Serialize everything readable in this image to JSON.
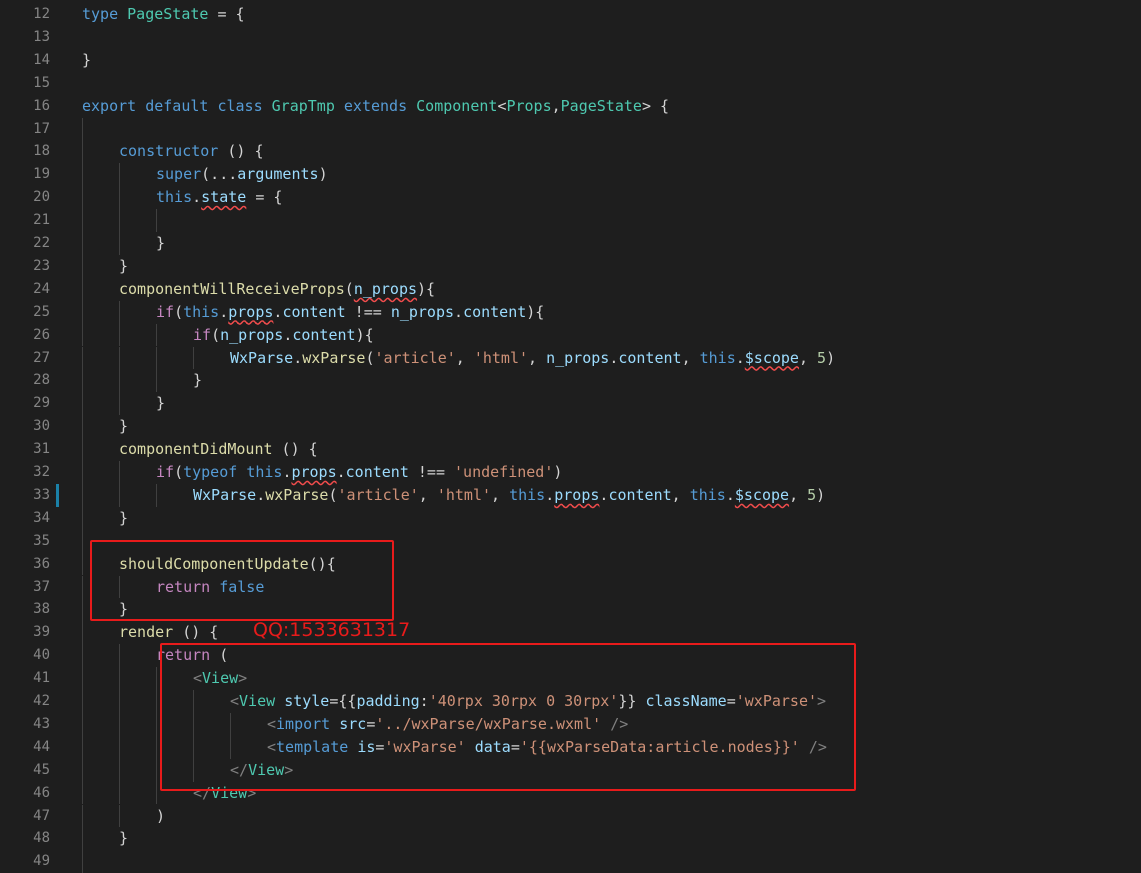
{
  "editor": {
    "lines": [
      {
        "n": "12",
        "indent": 0,
        "t": [
          [
            "kw",
            "type"
          ],
          [
            "pl",
            " "
          ],
          [
            "ty",
            "PageState"
          ],
          [
            "pl",
            " = {"
          ]
        ]
      },
      {
        "n": "13",
        "indent": 0,
        "t": []
      },
      {
        "n": "14",
        "indent": 0,
        "t": [
          [
            "pl",
            "}"
          ]
        ]
      },
      {
        "n": "15",
        "indent": 0,
        "t": []
      },
      {
        "n": "16",
        "indent": 0,
        "t": [
          [
            "kw",
            "export"
          ],
          [
            "pl",
            " "
          ],
          [
            "kw",
            "default"
          ],
          [
            "pl",
            " "
          ],
          [
            "kw",
            "class"
          ],
          [
            "pl",
            " "
          ],
          [
            "ty",
            "GrapTmp"
          ],
          [
            "pl",
            " "
          ],
          [
            "kw",
            "extends"
          ],
          [
            "pl",
            " "
          ],
          [
            "ty",
            "Component"
          ],
          [
            "pl",
            "<"
          ],
          [
            "ty",
            "Props"
          ],
          [
            "pl",
            ","
          ],
          [
            "ty",
            "PageState"
          ],
          [
            "pl",
            "> {"
          ]
        ]
      },
      {
        "n": "17",
        "indent": 1,
        "t": []
      },
      {
        "n": "18",
        "indent": 1,
        "t": [
          [
            "kw",
            "constructor"
          ],
          [
            "pl",
            " () {"
          ]
        ]
      },
      {
        "n": "19",
        "indent": 2,
        "t": [
          [
            "kw",
            "super"
          ],
          [
            "pl",
            "(..."
          ],
          [
            "var",
            "arguments"
          ],
          [
            "pl",
            ")"
          ]
        ]
      },
      {
        "n": "20",
        "indent": 2,
        "t": [
          [
            "kw",
            "this"
          ],
          [
            "pl",
            "."
          ],
          [
            "var sq",
            "state"
          ],
          [
            "pl",
            " = {"
          ]
        ]
      },
      {
        "n": "21",
        "indent": 3,
        "t": []
      },
      {
        "n": "22",
        "indent": 2,
        "t": [
          [
            "pl",
            "}"
          ]
        ]
      },
      {
        "n": "23",
        "indent": 1,
        "t": [
          [
            "pl",
            "}"
          ]
        ]
      },
      {
        "n": "24",
        "indent": 1,
        "t": [
          [
            "fn",
            "componentWillReceiveProps"
          ],
          [
            "pl",
            "("
          ],
          [
            "var sq",
            "n_props"
          ],
          [
            "pl",
            "){"
          ]
        ]
      },
      {
        "n": "25",
        "indent": 2,
        "t": [
          [
            "ctl",
            "if"
          ],
          [
            "pl",
            "("
          ],
          [
            "kw",
            "this"
          ],
          [
            "pl",
            "."
          ],
          [
            "var sq",
            "props"
          ],
          [
            "pl",
            "."
          ],
          [
            "var",
            "content"
          ],
          [
            "pl",
            " !== "
          ],
          [
            "var",
            "n_props"
          ],
          [
            "pl",
            "."
          ],
          [
            "var",
            "content"
          ],
          [
            "pl",
            "){"
          ]
        ]
      },
      {
        "n": "26",
        "indent": 3,
        "t": [
          [
            "ctl",
            "if"
          ],
          [
            "pl",
            "("
          ],
          [
            "var",
            "n_props"
          ],
          [
            "pl",
            "."
          ],
          [
            "var",
            "content"
          ],
          [
            "pl",
            "){"
          ]
        ]
      },
      {
        "n": "27",
        "indent": 4,
        "t": [
          [
            "var",
            "WxParse"
          ],
          [
            "pl",
            "."
          ],
          [
            "fn",
            "wxParse"
          ],
          [
            "pl",
            "("
          ],
          [
            "str",
            "'article'"
          ],
          [
            "pl",
            ", "
          ],
          [
            "str",
            "'html'"
          ],
          [
            "pl",
            ", "
          ],
          [
            "var",
            "n_props"
          ],
          [
            "pl",
            "."
          ],
          [
            "var",
            "content"
          ],
          [
            "pl",
            ", "
          ],
          [
            "kw",
            "this"
          ],
          [
            "pl",
            "."
          ],
          [
            "var sq",
            "$scope"
          ],
          [
            "pl",
            ", "
          ],
          [
            "num",
            "5"
          ],
          [
            "pl",
            ")"
          ]
        ]
      },
      {
        "n": "28",
        "indent": 3,
        "t": [
          [
            "pl",
            "}"
          ]
        ]
      },
      {
        "n": "29",
        "indent": 2,
        "t": [
          [
            "pl",
            "}"
          ]
        ]
      },
      {
        "n": "30",
        "indent": 1,
        "t": [
          [
            "pl",
            "}"
          ]
        ]
      },
      {
        "n": "31",
        "indent": 1,
        "t": [
          [
            "fn",
            "componentDidMount"
          ],
          [
            "pl",
            " () {"
          ]
        ]
      },
      {
        "n": "32",
        "indent": 2,
        "t": [
          [
            "ctl",
            "if"
          ],
          [
            "pl",
            "("
          ],
          [
            "kw",
            "typeof"
          ],
          [
            "pl",
            " "
          ],
          [
            "kw",
            "this"
          ],
          [
            "pl",
            "."
          ],
          [
            "var sq",
            "props"
          ],
          [
            "pl",
            "."
          ],
          [
            "var",
            "content"
          ],
          [
            "pl",
            " !== "
          ],
          [
            "str",
            "'undefined'"
          ],
          [
            "pl",
            ")"
          ]
        ]
      },
      {
        "n": "33",
        "indent": 3,
        "t": [
          [
            "var",
            "WxParse"
          ],
          [
            "pl",
            "."
          ],
          [
            "fn",
            "wxParse"
          ],
          [
            "pl",
            "("
          ],
          [
            "str",
            "'article'"
          ],
          [
            "pl",
            ", "
          ],
          [
            "str",
            "'html'"
          ],
          [
            "pl",
            ", "
          ],
          [
            "kw",
            "this"
          ],
          [
            "pl",
            "."
          ],
          [
            "var sq",
            "props"
          ],
          [
            "pl",
            "."
          ],
          [
            "var",
            "content"
          ],
          [
            "pl",
            ", "
          ],
          [
            "kw",
            "this"
          ],
          [
            "pl",
            "."
          ],
          [
            "var sq",
            "$scope"
          ],
          [
            "pl",
            ", "
          ],
          [
            "num",
            "5"
          ],
          [
            "pl",
            ")"
          ]
        ]
      },
      {
        "n": "34",
        "indent": 1,
        "t": [
          [
            "pl",
            "}"
          ]
        ]
      },
      {
        "n": "35",
        "indent": 1,
        "t": []
      },
      {
        "n": "36",
        "indent": 1,
        "t": [
          [
            "fn",
            "shouldComponentUpdate"
          ],
          [
            "pl",
            "(){"
          ]
        ]
      },
      {
        "n": "37",
        "indent": 2,
        "t": [
          [
            "ctl",
            "return"
          ],
          [
            "pl",
            " "
          ],
          [
            "kw",
            "false"
          ]
        ]
      },
      {
        "n": "38",
        "indent": 1,
        "t": [
          [
            "pl",
            "}"
          ]
        ]
      },
      {
        "n": "39",
        "indent": 1,
        "t": [
          [
            "fn",
            "render"
          ],
          [
            "pl",
            " () {"
          ]
        ]
      },
      {
        "n": "40",
        "indent": 2,
        "t": [
          [
            "ctl",
            "return"
          ],
          [
            "pl",
            " ("
          ]
        ]
      },
      {
        "n": "41",
        "indent": 3,
        "t": [
          [
            "tagp",
            "<"
          ],
          [
            "tag",
            "View"
          ],
          [
            "tagp",
            ">"
          ]
        ]
      },
      {
        "n": "42",
        "indent": 4,
        "t": [
          [
            "tagp",
            "<"
          ],
          [
            "tag",
            "View"
          ],
          [
            "pl",
            " "
          ],
          [
            "var",
            "style"
          ],
          [
            "pl",
            "={{"
          ],
          [
            "var",
            "padding"
          ],
          [
            "pl",
            ":"
          ],
          [
            "str",
            "'40rpx 30rpx 0 30rpx'"
          ],
          [
            "pl",
            "}} "
          ],
          [
            "var",
            "className"
          ],
          [
            "pl",
            "="
          ],
          [
            "str",
            "'wxParse'"
          ],
          [
            "tagp",
            ">"
          ]
        ]
      },
      {
        "n": "43",
        "indent": 5,
        "t": [
          [
            "tagp",
            "<"
          ],
          [
            "kw",
            "import"
          ],
          [
            "pl",
            " "
          ],
          [
            "var",
            "src"
          ],
          [
            "pl",
            "="
          ],
          [
            "str",
            "'../wxParse/wxParse.wxml'"
          ],
          [
            "pl",
            " "
          ],
          [
            "tagp",
            "/>"
          ]
        ]
      },
      {
        "n": "44",
        "indent": 5,
        "t": [
          [
            "tagp",
            "<"
          ],
          [
            "kw",
            "template"
          ],
          [
            "pl",
            " "
          ],
          [
            "var",
            "is"
          ],
          [
            "pl",
            "="
          ],
          [
            "str",
            "'wxParse'"
          ],
          [
            "pl",
            " "
          ],
          [
            "var",
            "data"
          ],
          [
            "pl",
            "="
          ],
          [
            "str",
            "'{{wxParseData:article.nodes}}'"
          ],
          [
            "pl",
            " "
          ],
          [
            "tagp",
            "/>"
          ]
        ]
      },
      {
        "n": "45",
        "indent": 4,
        "t": [
          [
            "tagp",
            "</"
          ],
          [
            "tag",
            "View"
          ],
          [
            "tagp",
            ">"
          ]
        ]
      },
      {
        "n": "46",
        "indent": 3,
        "t": [
          [
            "tagp",
            "</"
          ],
          [
            "tag",
            "View"
          ],
          [
            "tagp",
            ">"
          ]
        ]
      },
      {
        "n": "47",
        "indent": 2,
        "t": [
          [
            "pl",
            ")"
          ]
        ]
      },
      {
        "n": "48",
        "indent": 1,
        "t": [
          [
            "pl",
            "}"
          ]
        ]
      },
      {
        "n": "49",
        "indent": 1,
        "t": []
      }
    ],
    "modified_line": "33"
  },
  "annotation": {
    "text": "QQ:1533631317",
    "color": "#e81b1b"
  }
}
